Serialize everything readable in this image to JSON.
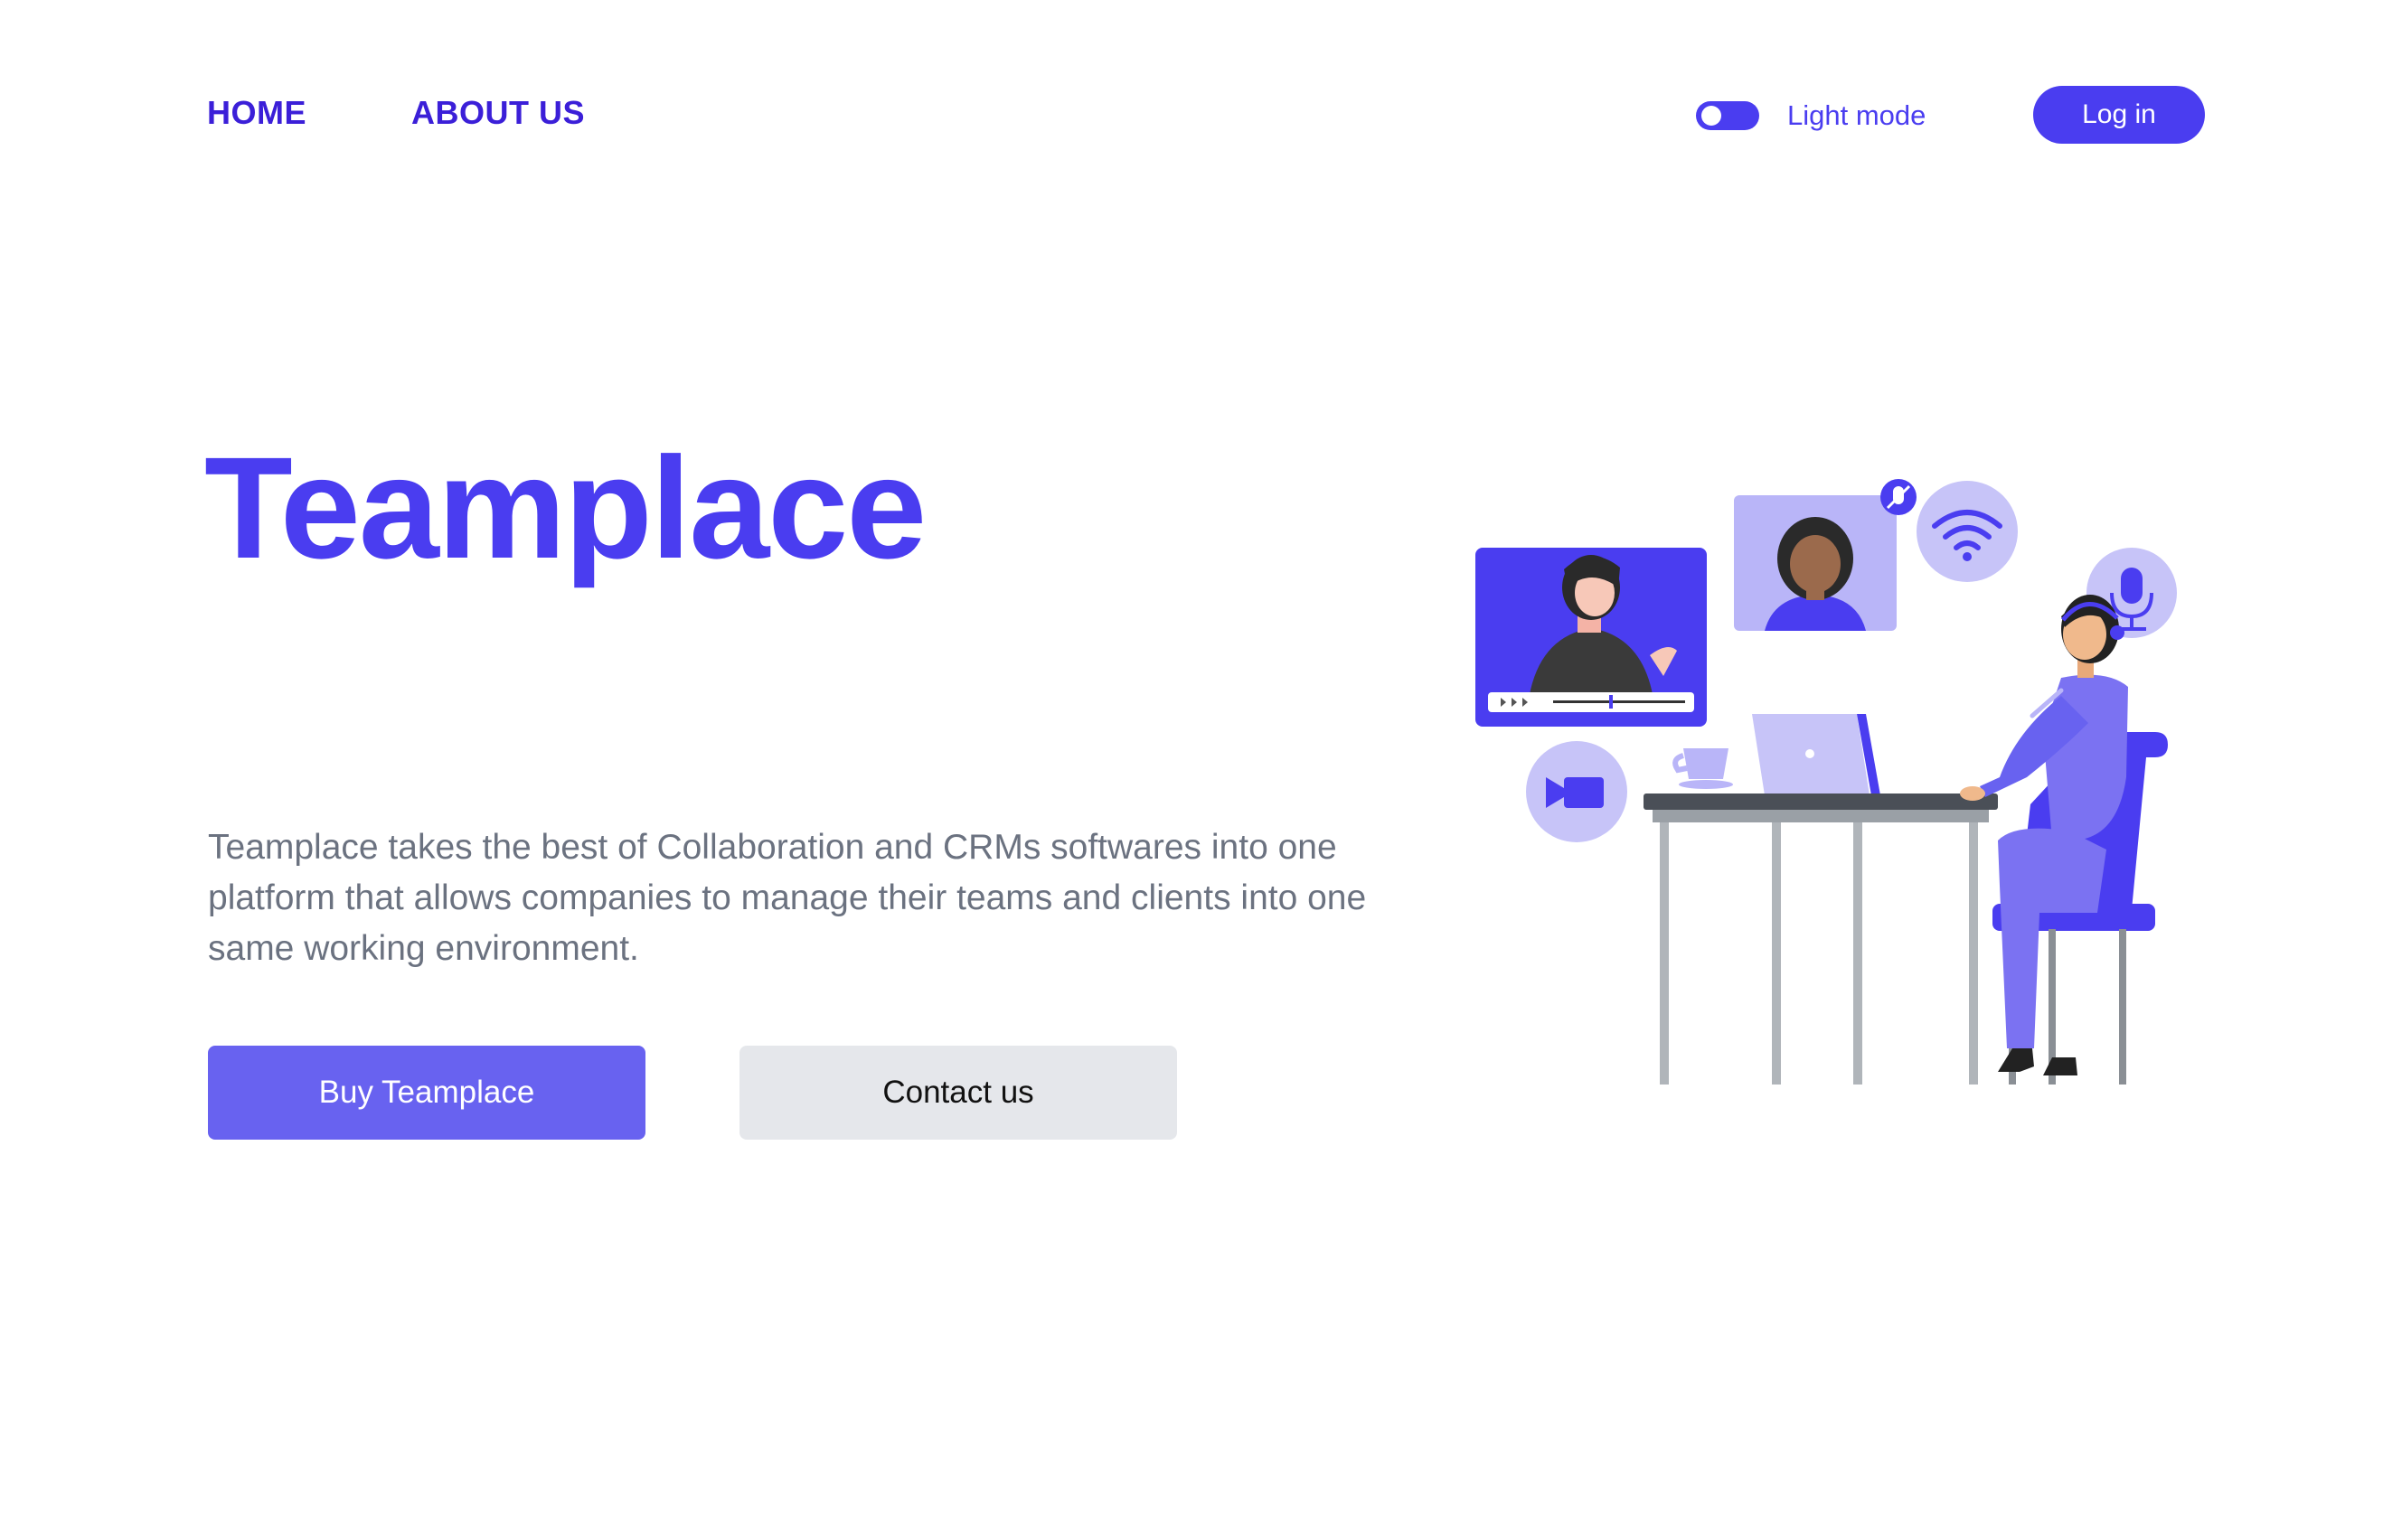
{
  "nav": {
    "home_label": "HOME",
    "about_label": "ABOUT US"
  },
  "theme": {
    "toggle_label": "Light mode",
    "accent": "#4a3df0",
    "button_primary": "#6862f0",
    "button_secondary": "#e5e7eb",
    "text_muted": "#6b7280"
  },
  "auth": {
    "login_label": "Log in"
  },
  "hero": {
    "title": "Teamplace",
    "description": "Teamplace takes the best of Collaboration and CRMs softwares into one platform that allows companies to manage their teams and clients into one same working environment.",
    "buy_label": "Buy Teamplace",
    "contact_label": "Contact us"
  },
  "illustration": {
    "icons": [
      "video-call-tile-icon",
      "participant-tile-icon",
      "mute-icon",
      "wifi-icon",
      "microphone-icon",
      "video-camera-icon"
    ]
  }
}
